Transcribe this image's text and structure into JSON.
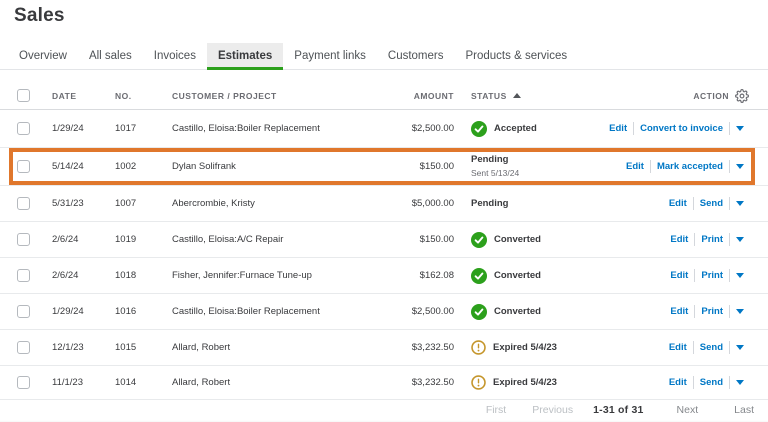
{
  "page_title": "Sales",
  "colors": {
    "green": "#2CA01C",
    "link_blue": "#0077C5",
    "highlight_orange": "#E0772C",
    "warning_amber": "#C5962C"
  },
  "tabs": [
    {
      "label": "Overview",
      "active": false
    },
    {
      "label": "All sales",
      "active": false
    },
    {
      "label": "Invoices",
      "active": false
    },
    {
      "label": "Estimates",
      "active": true
    },
    {
      "label": "Payment links",
      "active": false
    },
    {
      "label": "Customers",
      "active": false
    },
    {
      "label": "Products & services",
      "active": false
    }
  ],
  "table": {
    "headers": {
      "date": "DATE",
      "no": "NO.",
      "customer": "CUSTOMER / PROJECT",
      "amount": "AMOUNT",
      "status": "STATUS",
      "action": "ACTION"
    },
    "status_sorted": true,
    "rows": [
      {
        "date": "1/29/24",
        "no": "1017",
        "customer": "Castillo, Eloisa:Boiler Replacement",
        "amount": "$2,500.00",
        "status": {
          "icon": "check-circle-icon",
          "label": "Accepted"
        },
        "actions": [
          "Edit",
          "Convert to invoice"
        ],
        "highlighted": false
      },
      {
        "date": "5/14/24",
        "no": "1002",
        "customer": "Dylan Solifrank",
        "amount": "$150.00",
        "status": {
          "icon": null,
          "label": "Pending",
          "sub": "Sent 5/13/24"
        },
        "actions": [
          "Edit",
          "Mark accepted"
        ],
        "highlighted": true
      },
      {
        "date": "5/31/23",
        "no": "1007",
        "customer": "Abercrombie, Kristy",
        "amount": "$5,000.00",
        "status": {
          "icon": null,
          "label": "Pending"
        },
        "actions": [
          "Edit",
          "Send"
        ],
        "highlighted": false
      },
      {
        "date": "2/6/24",
        "no": "1019",
        "customer": "Castillo, Eloisa:A/C Repair",
        "amount": "$150.00",
        "status": {
          "icon": "check-circle-icon",
          "label": "Converted"
        },
        "actions": [
          "Edit",
          "Print"
        ],
        "highlighted": false
      },
      {
        "date": "2/6/24",
        "no": "1018",
        "customer": "Fisher, Jennifer:Furnace Tune-up",
        "amount": "$162.08",
        "status": {
          "icon": "check-circle-icon",
          "label": "Converted"
        },
        "actions": [
          "Edit",
          "Print"
        ],
        "highlighted": false
      },
      {
        "date": "1/29/24",
        "no": "1016",
        "customer": "Castillo, Eloisa:Boiler Replacement",
        "amount": "$2,500.00",
        "status": {
          "icon": "check-circle-icon",
          "label": "Converted"
        },
        "actions": [
          "Edit",
          "Print"
        ],
        "highlighted": false
      },
      {
        "date": "12/1/23",
        "no": "1015",
        "customer": "Allard, Robert",
        "amount": "$3,232.50",
        "status": {
          "icon": "warning-circle-icon",
          "label": "Expired 5/4/23"
        },
        "actions": [
          "Edit",
          "Send"
        ],
        "highlighted": false
      },
      {
        "date": "11/1/23",
        "no": "1014",
        "customer": "Allard, Robert",
        "amount": "$3,232.50",
        "status": {
          "icon": "warning-circle-icon",
          "label": "Expired 5/4/23"
        },
        "actions": [
          "Edit",
          "Send"
        ],
        "highlighted": false
      }
    ]
  },
  "pagination": [
    {
      "label": "First",
      "state": "disabled"
    },
    {
      "label": "Previous",
      "state": "disabled"
    },
    {
      "label": "1-31 of 31",
      "state": "count"
    },
    {
      "label": "Next",
      "state": "enabled"
    },
    {
      "label": "Last",
      "state": "enabled"
    }
  ]
}
